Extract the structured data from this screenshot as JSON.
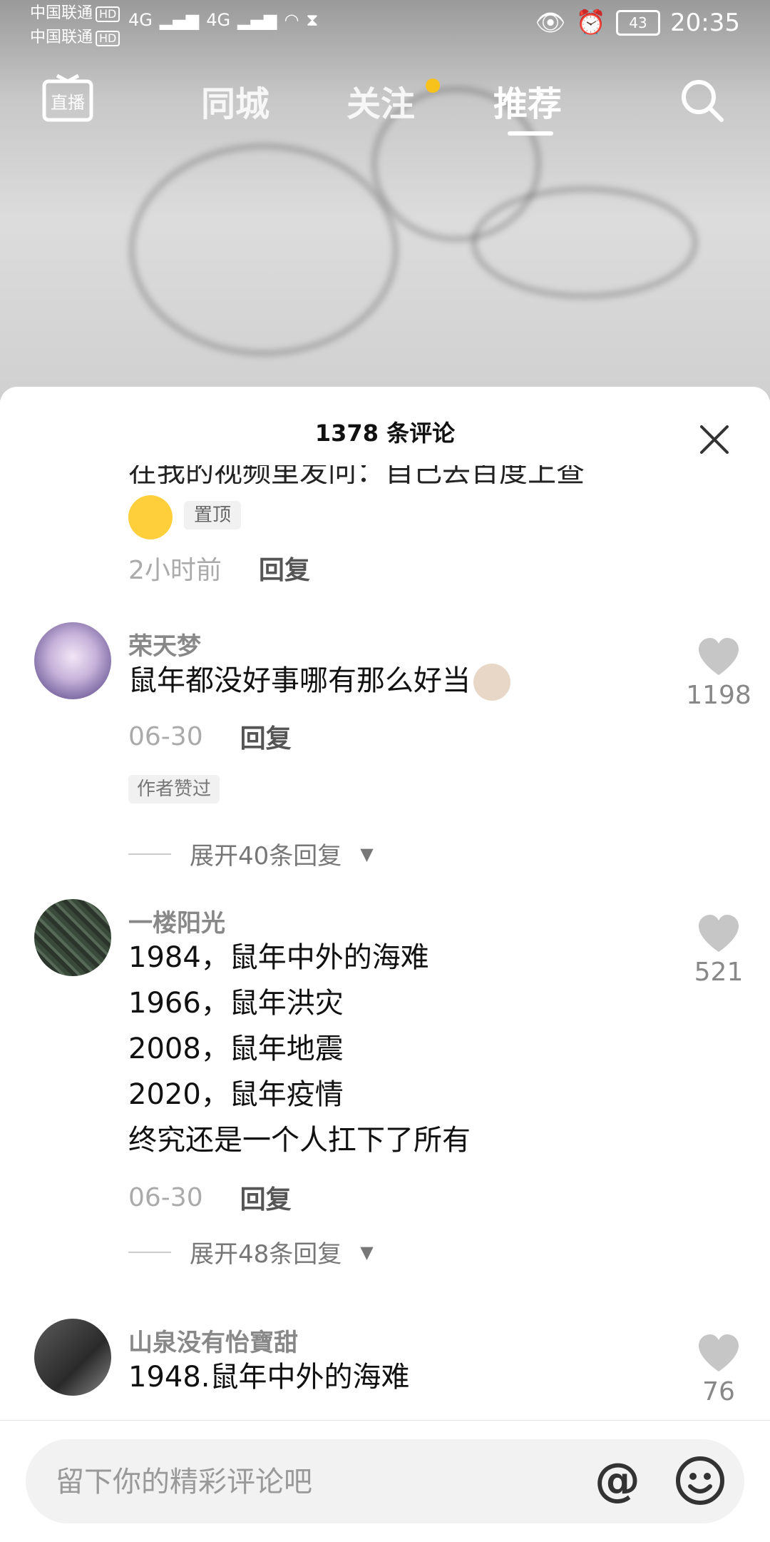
{
  "status_bar": {
    "carrier_1": "中国联通",
    "carrier_2": "中国联通",
    "hd": "HD",
    "signal_1": "4G",
    "signal_2": "4G",
    "battery": "43",
    "time": "20:35"
  },
  "nav": {
    "live_label": "直播",
    "tabs": [
      {
        "label": "同城"
      },
      {
        "label": "关注"
      },
      {
        "label": "推荐"
      }
    ],
    "active_tab": "推荐",
    "notification_dot_color": "#f8c21c"
  },
  "comments_panel": {
    "title": "1378 条评论",
    "pinned": {
      "partial_text": "在我的视频里发问：自己去百度上查",
      "badge": "置顶",
      "time": "2小时前",
      "reply_label": "回复"
    },
    "comments": [
      {
        "username": "荣天梦",
        "lines": [
          "鼠年都没好事哪有那么好当"
        ],
        "time": "06-30",
        "reply_label": "回复",
        "likes": "1198",
        "author_badge": "作者赞过",
        "expand_label": "展开40条回复"
      },
      {
        "username": "一楼阳光",
        "lines": [
          "1984，鼠年中外的海难",
          "1966，鼠年洪灾",
          "2008，鼠年地震",
          "2020，鼠年疫情",
          "终究还是一个人扛下了所有"
        ],
        "time": "06-30",
        "reply_label": "回复",
        "likes": "521",
        "expand_label": "展开48条回复"
      },
      {
        "username": "山泉没有怡寶甜",
        "lines": [
          "1948.鼠年中外的海难"
        ],
        "likes": "76"
      }
    ]
  },
  "input": {
    "placeholder": "留下你的精彩评论吧",
    "at_symbol": "@"
  },
  "colors": {
    "accent_dot": "#f8c21c",
    "sheet_bg": "#ffffff",
    "muted_text": "#888888"
  }
}
